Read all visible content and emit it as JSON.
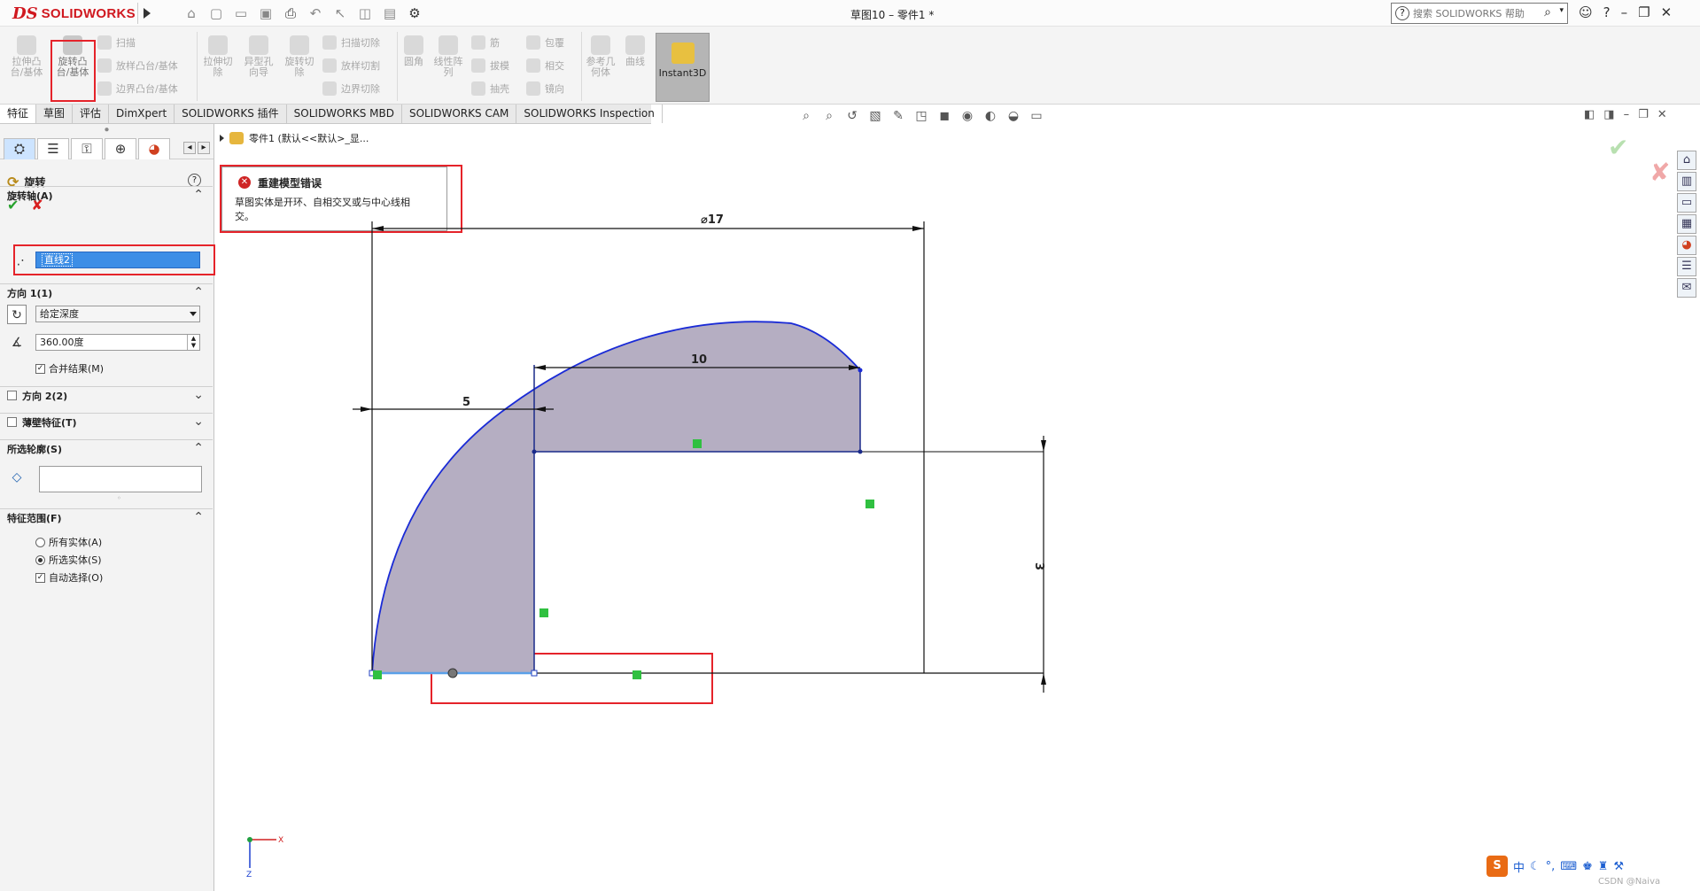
{
  "app": {
    "logo_ds": "DS",
    "logo_text": "SOLIDWORKS",
    "doc_title": "草图10 – 零件1 *",
    "help_placeholder": "搜索 SOLIDWORKS 帮助"
  },
  "ribbon": {
    "extrude_boss": "拉伸凸\n台/基体",
    "revolve_boss": "旋转凸\n台/基体",
    "sweep": "扫描",
    "loft": "放样凸台/基体",
    "boundary": "边界凸台/基体",
    "extrude_cut": "拉伸切\n除",
    "hole_wizard": "异型孔\n向导",
    "revolve_cut": "旋转切\n除",
    "swept_cut": "扫描切除",
    "lofted_cut": "放样切割",
    "boundary_cut": "边界切除",
    "fillet": "圆角",
    "linear_pattern": "线性阵\n列",
    "rib": "筋",
    "draft": "拔模",
    "shell": "抽壳",
    "wrap": "包覆",
    "intersect": "相交",
    "mirror": "镜向",
    "ref_geometry": "参考几\n何体",
    "curves": "曲线",
    "instant3d": "Instant3D"
  },
  "tabs": [
    "特征",
    "草图",
    "评估",
    "DimXpert",
    "SOLIDWORKS 插件",
    "SOLIDWORKS MBD",
    "SOLIDWORKS CAM",
    "SOLIDWORKS Inspection"
  ],
  "panel": {
    "title": "旋转",
    "help": "?",
    "axis_label": "旋转轴(A)",
    "axis_value": "直线2",
    "dir1_label": "方向 1(1)",
    "dir1_type": "给定深度",
    "dir1_angle": "360.00度",
    "merge": "合并结果(M)",
    "dir2_label": "方向 2(2)",
    "thin_label": "薄壁特征(T)",
    "contour_label": "所选轮廓(S)",
    "scope_label": "特征范围(F)",
    "scope_all": "所有实体(A)",
    "scope_selected": "所选实体(S)",
    "auto_select": "自动选择(O)"
  },
  "error": {
    "title": "重建模型错误",
    "message": "草图实体是开环、自相交叉或与中心线相交。"
  },
  "breadcrumb": "零件1  (默认<<默认>_显...",
  "dims": {
    "diameter": "⌀17",
    "d10": "10",
    "d5": "5",
    "d3": "3"
  },
  "triad": {
    "x": "X",
    "z": "Z"
  },
  "ime": {
    "s": "S",
    "zh": "中"
  },
  "watermark": "CSDN @Naiva"
}
